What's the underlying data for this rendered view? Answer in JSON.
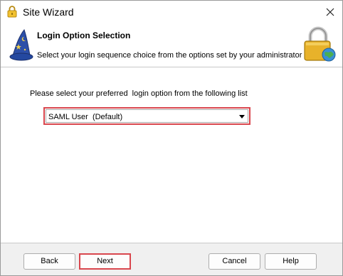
{
  "window": {
    "title": "Site Wizard"
  },
  "header": {
    "title": "Login Option Selection",
    "subtitle": "Select your login sequence choice from the options set by your administrator"
  },
  "main": {
    "prompt": "Please select your preferred  login option from the following list",
    "login_option": {
      "selected": "SAML User  (Default)"
    }
  },
  "footer": {
    "back_label": "Back",
    "next_label": "Next",
    "cancel_label": "Cancel",
    "help_label": "Help"
  },
  "colors": {
    "highlight": "#d9464d",
    "footer_bg": "#f0f0f0",
    "lock_gold": "#e8b22a",
    "wizard_blue": "#2d4fa8"
  },
  "icons": [
    "lock-icon",
    "close-icon",
    "wizard-hat-icon",
    "padlock-globe-icon",
    "dropdown-arrow-icon"
  ]
}
